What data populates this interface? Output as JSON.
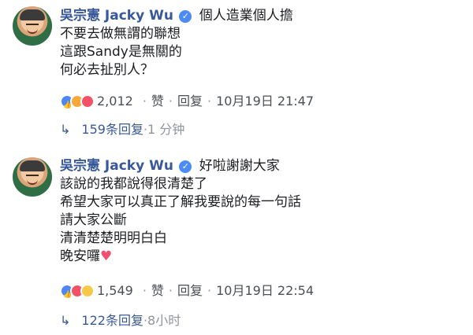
{
  "comments": [
    {
      "author": "吳宗憲 Jacky Wu",
      "lines": [
        "個人造業個人擔",
        "不要去做無謂的聯想",
        "這跟Sandy是無關的",
        "何必去扯別人？"
      ],
      "reactions": [
        "like-icon",
        "angry-icon",
        "love-icon"
      ],
      "reaction_count": "2,012",
      "like_label": "赞",
      "reply_label": "回复",
      "timestamp": "10月19日 21:47",
      "replies_count": "159条回复",
      "replies_time": "1 分钟"
    },
    {
      "author": "吳宗憲 Jacky Wu",
      "lines": [
        "好啦謝謝大家",
        "該說的我都說得很清楚了",
        "希望大家可以真正了解我要說的每一句話",
        "請大家公斷",
        "清清楚楚明明白白",
        "晚安囉"
      ],
      "emoji": "♥",
      "reactions": [
        "like-icon",
        "love-icon",
        "haha-icon"
      ],
      "reaction_count": "1,549",
      "like_label": "赞",
      "reply_label": "回复",
      "timestamp": "10月19日 22:54",
      "replies_count": "122条回复",
      "replies_time": "8小时"
    }
  ],
  "separator": "·",
  "verified_mark": "✓",
  "reply_arrow": "↳",
  "colors": {
    "author": "#385898",
    "meta": "#90949c",
    "heart": "#f0506e",
    "like": "#4f86f7"
  }
}
